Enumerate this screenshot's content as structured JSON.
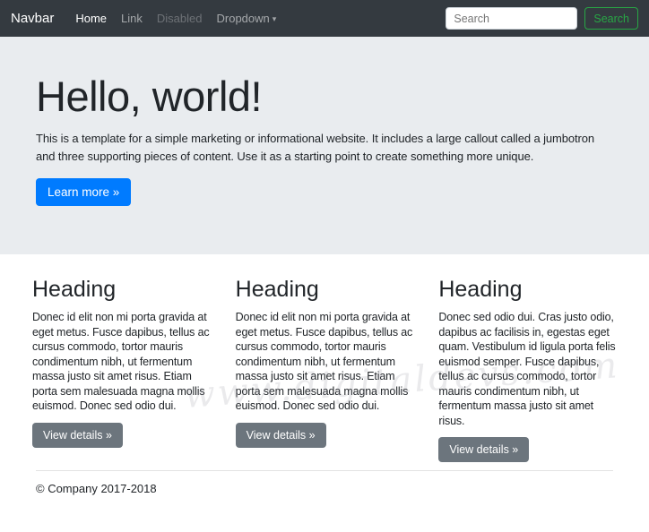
{
  "navbar": {
    "brand": "Navbar",
    "items": [
      {
        "label": "Home",
        "state": "active"
      },
      {
        "label": "Link",
        "state": "normal"
      },
      {
        "label": "Disabled",
        "state": "disabled"
      },
      {
        "label": "Dropdown",
        "state": "dropdown"
      }
    ],
    "icons": {
      "caret_down": "▾"
    },
    "search": {
      "placeholder": "Search",
      "button_label": "Search"
    }
  },
  "jumbotron": {
    "title": "Hello, world!",
    "lead": "This is a template for a simple marketing or informational website. It includes a large callout called a jumbotron and three supporting pieces of content. Use it as a starting point to create something more unique.",
    "cta_label": "Learn more »"
  },
  "columns": [
    {
      "heading": "Heading",
      "body": "Donec id elit non mi porta gravida at eget metus. Fusce dapibus, tellus ac cursus commodo, tortor mauris condimentum nibh, ut fermentum massa justo sit amet risus. Etiam porta sem malesuada magna mollis euismod. Donec sed odio dui.",
      "button_label": "View details »"
    },
    {
      "heading": "Heading",
      "body": "Donec id elit non mi porta gravida at eget metus. Fusce dapibus, tellus ac cursus commodo, tortor mauris condimentum nibh, ut fermentum massa justo sit amet risus. Etiam porta sem malesuada magna mollis euismod. Donec sed odio dui.",
      "button_label": "View details »"
    },
    {
      "heading": "Heading",
      "body": "Donec sed odio dui. Cras justo odio, dapibus ac facilisis in, egestas eget quam. Vestibulum id ligula porta felis euismod semper. Fusce dapibus, tellus ac cursus commodo, tortor mauris condimentum nibh, ut fermentum massa justo sit amet risus.",
      "button_label": "View details »"
    }
  ],
  "footer": {
    "copyright": "© Company 2017-2018"
  },
  "watermark": "www.digitaldevs.com",
  "colors": {
    "navbar_bg": "#343a40",
    "jumbotron_bg": "#e9ecef",
    "primary": "#007bff",
    "secondary": "#6c757d",
    "success_outline": "#28a745",
    "body_text": "#212529"
  }
}
